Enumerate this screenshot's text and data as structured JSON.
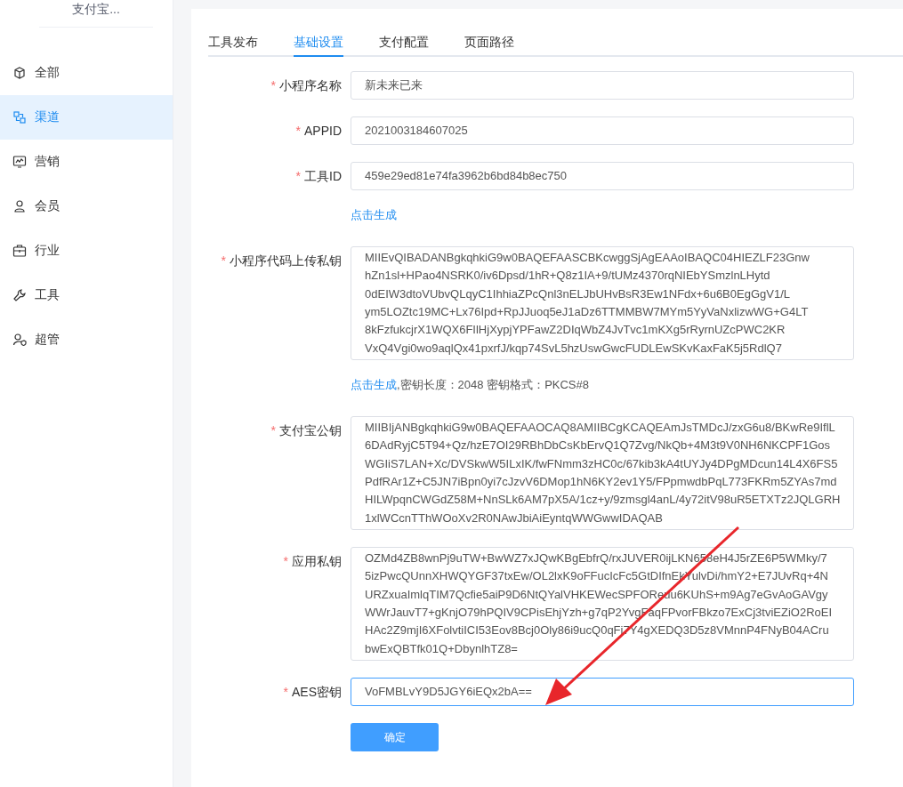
{
  "sidebar": {
    "title": "支付宝...",
    "items": [
      {
        "label": "全部",
        "selected": false
      },
      {
        "label": "渠道",
        "selected": true
      },
      {
        "label": "营销",
        "selected": false
      },
      {
        "label": "会员",
        "selected": false
      },
      {
        "label": "行业",
        "selected": false
      },
      {
        "label": "工具",
        "selected": false
      },
      {
        "label": "超管",
        "selected": false
      }
    ]
  },
  "tabs": [
    {
      "label": "工具发布",
      "selected": false
    },
    {
      "label": "基础设置",
      "selected": true
    },
    {
      "label": "支付配置",
      "selected": false
    },
    {
      "label": "页面路径",
      "selected": false
    }
  ],
  "form": {
    "fields": [
      {
        "kind": "input",
        "label": "小程序名称",
        "mark": "*",
        "value": "新未来已来",
        "focused": false
      },
      {
        "kind": "input",
        "label": "APPID",
        "mark": "*",
        "value": "2021003184607025",
        "focused": false
      },
      {
        "kind": "input",
        "label": "工具ID",
        "mark": "*",
        "value": "459e29ed81e74fa3962b6bd84b8ec750",
        "focused": false
      },
      {
        "kind": "link",
        "link": "点击生成"
      },
      {
        "kind": "textarea",
        "label": "小程序代码上传私钥",
        "mark": "*",
        "value": "MIIEvQIBADANBgkqhkiG9w0BAQEFAASCBKcwggSjAgEAAoIBAQC04HIEZLF23Gnw\nhZn1sl+HPao4NSRK0/iv6Dpsd/1hR+Q8z1IA+9/tUMz4370rqNIEbYSmzlnLHytd\n0dEIW3dtoVUbvQLqyC1IhhiaZPcQnl3nELJbUHvBsR3Ew1NFdx+6u6B0EgGgV1/L\nym5LOZtc19MC+Lx76Ipd+RpJJuoq5eJ1aDz6TTMMBW7MYm5YyVaNxlizwWG+G4LT\n8kFzfukcjrX1WQX6FIlHjXypjYPFawZ2DIqWbZ4JvTvc1mKXg5rRyrnUZcPWC2KR\nVxQ4Vgi0wo9aqlQx41pxrfJ/kqp74SvL5hzUswGwcFUDLEwSKvKaxFaK5j5RdlQ7"
      },
      {
        "kind": "hint",
        "link": "点击生成",
        "text": ",密钥长度：2048 密钥格式：PKCS#8"
      },
      {
        "kind": "textarea",
        "label": "支付宝公钥",
        "mark": "*",
        "value": "MIIBIjANBgkqhkiG9w0BAQEFAAOCAQ8AMIIBCgKCAQEAmJsTMDcJ/zxG6u8/BKwRe9IflL\n6DAdRyjC5T94+Qz/hzE7OI29RBhDbCsKbErvQ1Q7Zvg/NkQb+4M3t9V0NH6NKCPF1Gos\nWGIiS7LAN+Xc/DVSkwW5ILxIK/fwFNmm3zHC0c/67kib3kA4tUYJy4DPgMDcun14L4X6FS5\nPdfRAr1Z+C5JN7iBpn0yi7cJzvV6DMop1hN6KY2ev1Y5/FPpmwdbPqL773FKRm5ZYAs7md\nHILWpqnCWGdZ58M+NnSLk6AM7pX5A/1cz+y/9zmsgl4anL/4y72itV98uR5ETXTz2JQLGRH\n1xlWCcnTThWOoXv2R0NAwJbiAiEyntqWWGwwIDAQAB"
      },
      {
        "kind": "textarea",
        "label": "应用私钥",
        "mark": "*",
        "value": "OZMd4ZB8wnPj9uTW+BwWZ7xJQwKBgEbfrQ/rxJUVER0ijLKN658eH4J5rZE6P5WMky/7\n5izPwcQUnnXHWQYGF37txEw/OL2lxK9oFFucIcFc5GtDIfnEkYulvDi/hmY2+E7JUvRq+4N\nURZxuaImlqTIM7Qcfie5aiP9D6NtQYalVHKEWecSPFOReuu6KUhS+m9Ag7eGvAoGAVgy\nWWrJauvT7+gKnjO79hPQIV9CPisEhjYzh+g7qP2YvgFaqFPvorFBkzo7ExCj3tviEZiO2RoEI\nHAc2Z9mjI6XFolvtiICI53Eov8Bcj0Oly86i9ucQ0qFi7Y4gXEDQ3D5z8VMnnP4FNyB04ACru\nbwExQBTfk01Q+DbynlhTZ8="
      },
      {
        "kind": "input",
        "label": "AES密钥",
        "mark": "*",
        "value": "VoFMBLvY9D5JGY6iEQx2bA==",
        "focused": true
      }
    ],
    "submit": "确定"
  }
}
